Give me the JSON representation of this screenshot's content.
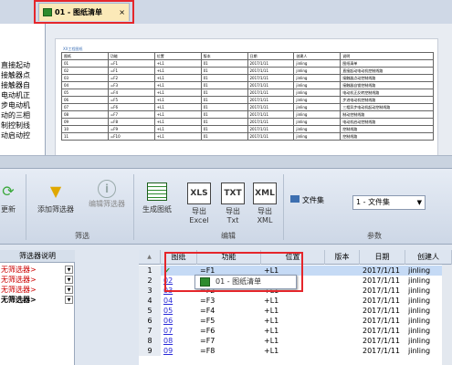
{
  "tab": {
    "title": "01 - 图纸清单",
    "close": "×"
  },
  "left_panel_lines": [
    "直接起动",
    "接触器点",
    "接触器自",
    "电动机正",
    "步电动机",
    "动的三相",
    "制控制线",
    "动启动控"
  ],
  "document": {
    "title": "XX工程图纸",
    "rows": [
      [
        "图纸",
        "功能",
        "位置",
        "版本",
        "日期",
        "创建人",
        "说明"
      ],
      [
        "01",
        "=F1",
        "+L1",
        "01",
        "2017/1/11",
        "jinling",
        "图纸清单"
      ],
      [
        "02",
        "=F1",
        "+L1",
        "01",
        "2017/1/11",
        "jinling",
        "直接起动电动机控制线路"
      ],
      [
        "03",
        "=F2",
        "+L1",
        "01",
        "2017/1/11",
        "jinling",
        "接触器点动控制线路"
      ],
      [
        "04",
        "=F3",
        "+L1",
        "01",
        "2017/1/11",
        "jinling",
        "接触器自锁控制线路"
      ],
      [
        "05",
        "=F4",
        "+L1",
        "01",
        "2017/1/11",
        "jinling",
        "电动机正反转控制线路"
      ],
      [
        "06",
        "=F5",
        "+L1",
        "01",
        "2017/1/11",
        "jinling",
        "步进电动机控制线路"
      ],
      [
        "07",
        "=F6",
        "+L1",
        "01",
        "2017/1/11",
        "jinling",
        "三相异步电动机起动控制线路"
      ],
      [
        "08",
        "=F7",
        "+L1",
        "01",
        "2017/1/11",
        "jinling",
        "制动控制线路"
      ],
      [
        "09",
        "=F8",
        "+L1",
        "01",
        "2017/1/11",
        "jinling",
        "电动机启动控制线路"
      ],
      [
        "10",
        "=F9",
        "+L1",
        "01",
        "2017/1/11",
        "jinling",
        "控制线路"
      ],
      [
        "11",
        "=F10",
        "+L1",
        "01",
        "2017/1/11",
        "jinling",
        "控制线路"
      ]
    ]
  },
  "ribbon": {
    "refresh": "更新",
    "add_filter": "添加筛选器",
    "edit_filter": "编辑筛选器",
    "filter_group": "筛选",
    "gen_drawing": "生成图纸",
    "export_excel_1": "导出",
    "export_excel_2": "Excel",
    "export_txt_1": "导出",
    "export_txt_2": "Txt",
    "export_xml_1": "导出",
    "export_xml_2": "XML",
    "edit_group": "编辑",
    "params_group": "参数",
    "file_set_label": "文件集",
    "file_set_value": "1 - 文件集",
    "xls": "XLS",
    "txt": "TXT",
    "xml": "XML"
  },
  "filter_panel": {
    "header": "筛选器说明",
    "rows": [
      "无筛选器>",
      "无筛选器>",
      "无筛选器>",
      "无筛选器>"
    ]
  },
  "grid": {
    "headers": [
      "",
      "图纸",
      "功能",
      "位置",
      "版本",
      "日期",
      "创建人"
    ],
    "rows": [
      {
        "n": "1",
        "dwg": "",
        "fn": "=F1",
        "loc": "+L1",
        "ver": "",
        "date": "2017/1/11",
        "user": "jinling"
      },
      {
        "n": "2",
        "dwg": "02",
        "fn": "",
        "loc": "",
        "ver": "",
        "date": "2017/1/11",
        "user": "jinling"
      },
      {
        "n": "3",
        "dwg": "03",
        "fn": "=F2",
        "loc": "+L1",
        "ver": "",
        "date": "2017/1/11",
        "user": "jinling"
      },
      {
        "n": "4",
        "dwg": "04",
        "fn": "=F3",
        "loc": "+L1",
        "ver": "",
        "date": "2017/1/11",
        "user": "jinling"
      },
      {
        "n": "5",
        "dwg": "05",
        "fn": "=F4",
        "loc": "+L1",
        "ver": "",
        "date": "2017/1/11",
        "user": "jinling"
      },
      {
        "n": "6",
        "dwg": "06",
        "fn": "=F5",
        "loc": "+L1",
        "ver": "",
        "date": "2017/1/11",
        "user": "jinling"
      },
      {
        "n": "7",
        "dwg": "07",
        "fn": "=F6",
        "loc": "+L1",
        "ver": "",
        "date": "2017/1/11",
        "user": "jinling"
      },
      {
        "n": "8",
        "dwg": "08",
        "fn": "=F7",
        "loc": "+L1",
        "ver": "",
        "date": "2017/1/11",
        "user": "jinling"
      },
      {
        "n": "9",
        "dwg": "09",
        "fn": "=F8",
        "loc": "+L1",
        "ver": "",
        "date": "2017/1/11",
        "user": "jinling"
      }
    ],
    "popup": "01 - 图纸清单"
  },
  "colors": {
    "highlight_red": "#e5262b",
    "selected_row": "#c5daf5",
    "link": "#2b2bd8"
  }
}
